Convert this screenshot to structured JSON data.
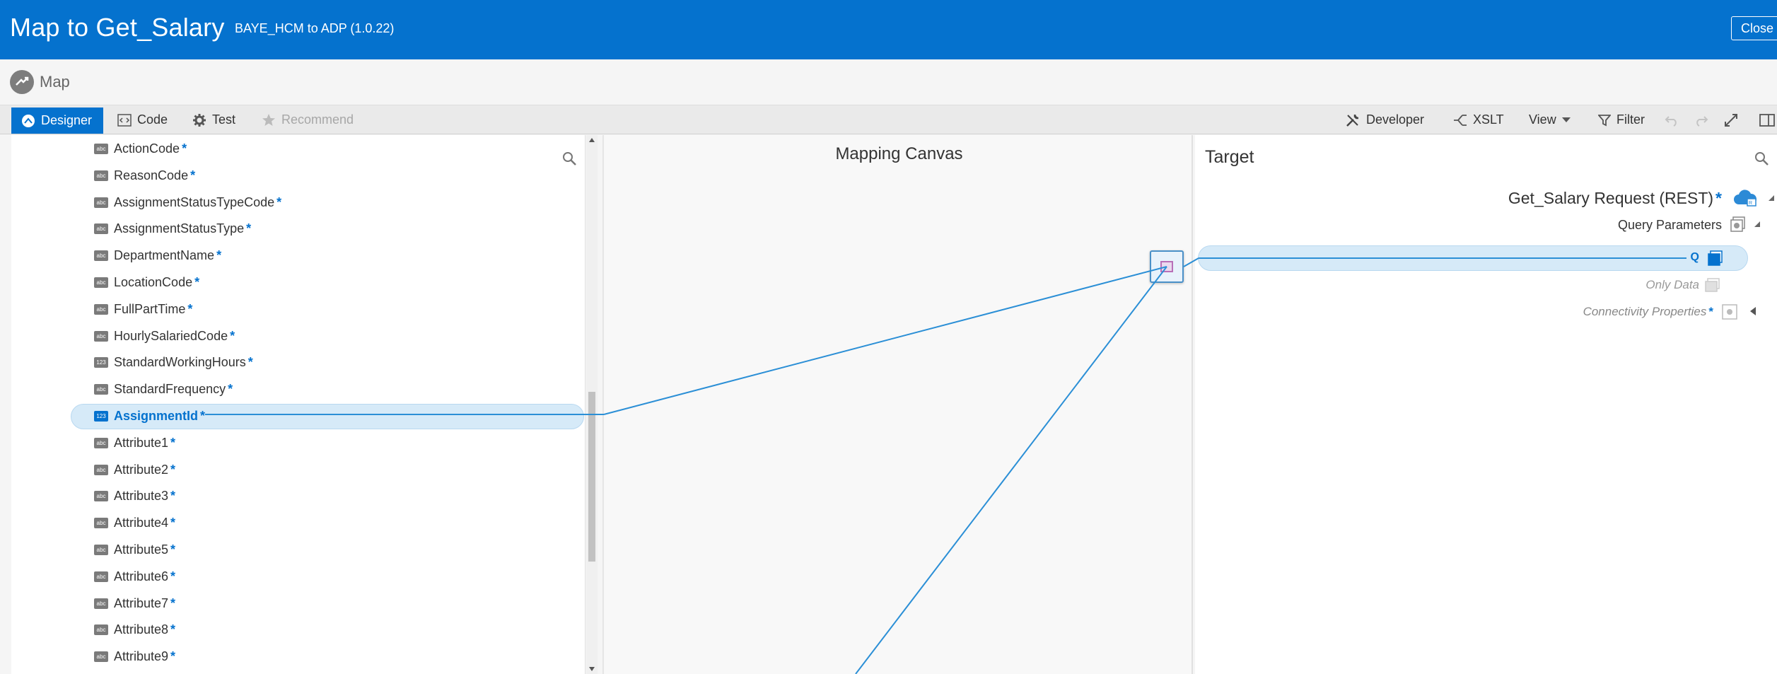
{
  "header": {
    "title": "Map to Get_Salary",
    "subtitle": "BAYE_HCM to ADP (1.0.22)",
    "close_label": "Close"
  },
  "map_row": {
    "label": "Map"
  },
  "toolbar": {
    "designer": "Designer",
    "code": "Code",
    "test": "Test",
    "recommend": "Recommend",
    "developer": "Developer",
    "xslt": "XSLT",
    "view": "View",
    "filter": "Filter"
  },
  "source_tree": {
    "items": [
      {
        "label": "ActionCode",
        "type": "abc",
        "required": "*"
      },
      {
        "label": "ReasonCode",
        "type": "abc",
        "required": "*"
      },
      {
        "label": "AssignmentStatusTypeCode",
        "type": "abc",
        "required": "*"
      },
      {
        "label": "AssignmentStatusType",
        "type": "abc",
        "required": "*"
      },
      {
        "label": "DepartmentName",
        "type": "abc",
        "required": "*"
      },
      {
        "label": "LocationCode",
        "type": "abc",
        "required": "*"
      },
      {
        "label": "FullPartTime",
        "type": "abc",
        "required": "*"
      },
      {
        "label": "HourlySalariedCode",
        "type": "abc",
        "required": "*"
      },
      {
        "label": "StandardWorkingHours",
        "type": "123",
        "required": "*"
      },
      {
        "label": "StandardFrequency",
        "type": "abc",
        "required": "*"
      },
      {
        "label": "AssignmentId",
        "type": "123",
        "required": "*",
        "selected": true
      },
      {
        "label": "Attribute1",
        "type": "abc",
        "required": "*"
      },
      {
        "label": "Attribute2",
        "type": "abc",
        "required": "*"
      },
      {
        "label": "Attribute3",
        "type": "abc",
        "required": "*"
      },
      {
        "label": "Attribute4",
        "type": "abc",
        "required": "*"
      },
      {
        "label": "Attribute5",
        "type": "abc",
        "required": "*"
      },
      {
        "label": "Attribute6",
        "type": "abc",
        "required": "*"
      },
      {
        "label": "Attribute7",
        "type": "abc",
        "required": "*"
      },
      {
        "label": "Attribute8",
        "type": "abc",
        "required": "*"
      },
      {
        "label": "Attribute9",
        "type": "abc",
        "required": "*"
      }
    ]
  },
  "canvas": {
    "title": "Mapping Canvas"
  },
  "target": {
    "title": "Target",
    "request_label": "Get_Salary Request (REST)",
    "request_required": "*",
    "query_params": "Query Parameters",
    "only_data": "Only Data",
    "connectivity": "Connectivity Properties",
    "connectivity_required": "*",
    "mapped_q": "Q"
  },
  "colors": {
    "brand": "#0572ce",
    "selected_bg": "#d6eaf8",
    "link_line": "#2b8fd6"
  }
}
